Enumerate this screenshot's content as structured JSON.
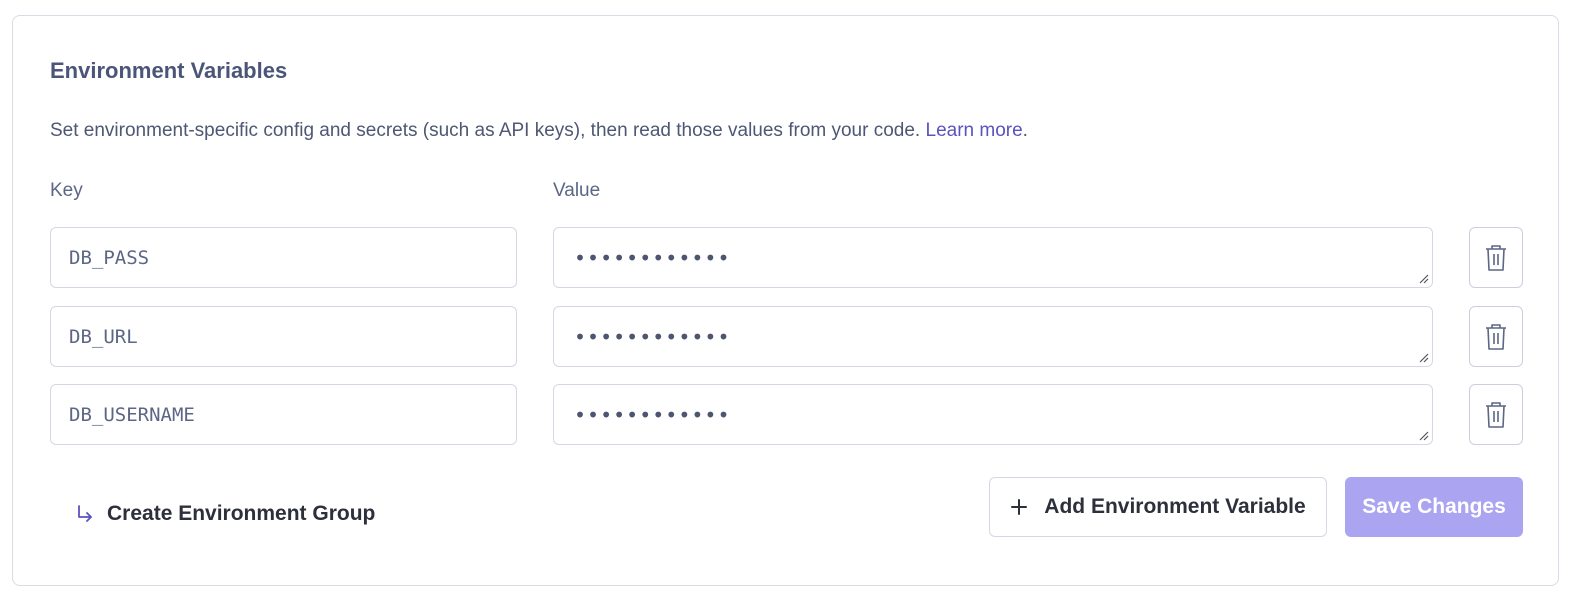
{
  "section": {
    "title": "Environment Variables",
    "description": "Set environment-specific config and secrets (such as API keys), then read those values from your code.",
    "learn_more": "Learn more",
    "period": "."
  },
  "columns": {
    "key": "Key",
    "value": "Value"
  },
  "variables": [
    {
      "key": "DB_PASS",
      "value": "••••••••••••"
    },
    {
      "key": "DB_URL",
      "value": "••••••••••••"
    },
    {
      "key": "DB_USERNAME",
      "value": "••••••••••••"
    }
  ],
  "actions": {
    "create_group": "Create Environment Group",
    "add_variable": "Add Environment Variable",
    "save": "Save Changes"
  },
  "colors": {
    "accent": "#5a52c0",
    "save_disabled": "#aaa4f1",
    "text": "#4a5578"
  },
  "icons": {
    "delete": "trash-icon",
    "add": "plus-icon",
    "create_group": "return-arrow-icon"
  }
}
